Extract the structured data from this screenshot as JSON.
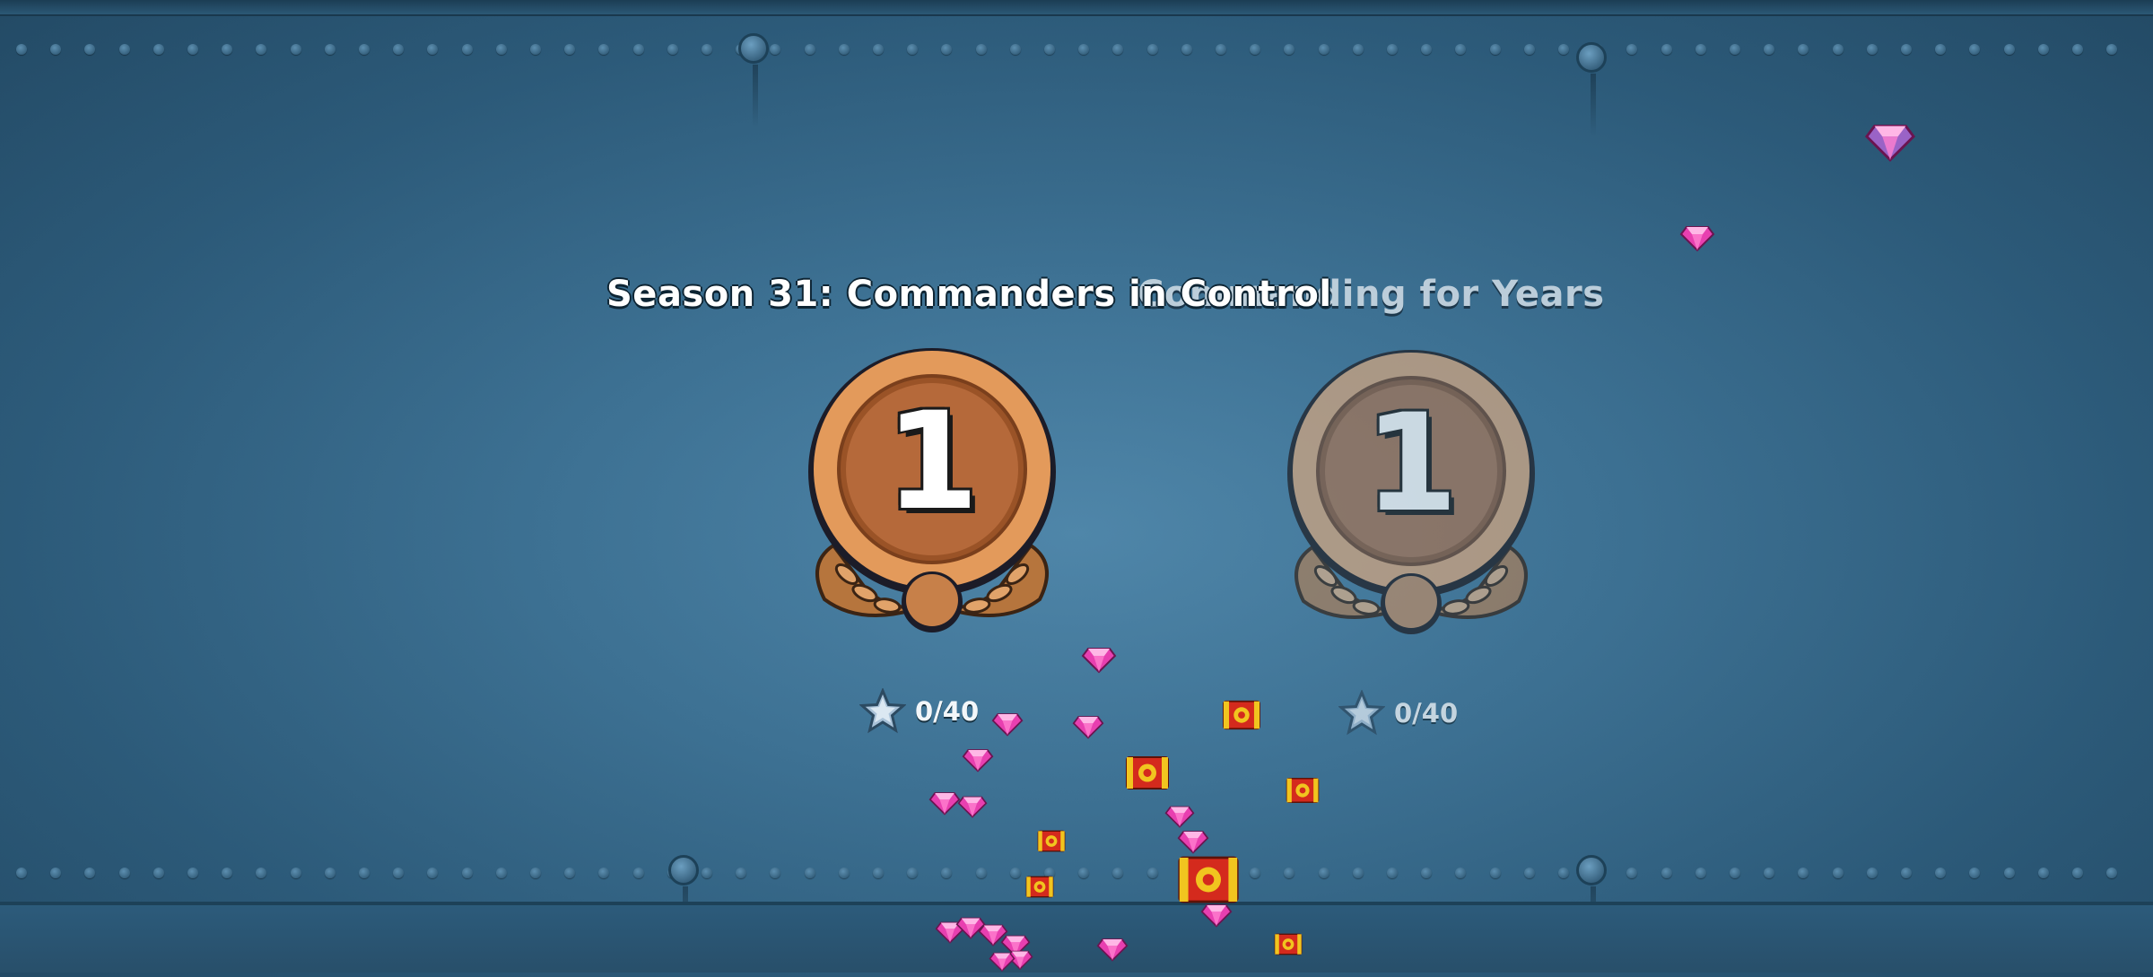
{
  "screen": {
    "seasons": [
      {
        "title": "Season 31: Commanders in Control",
        "rank": "1",
        "stars": "0/40",
        "active": true
      },
      {
        "title": "Commanding for Years",
        "rank": "1",
        "stars": "0/40",
        "active": false
      }
    ]
  },
  "icons": {
    "star": "star-icon",
    "gem": "gem-icon",
    "chest": "gear-chest-icon",
    "medal": "bronze-rank-medal-icon"
  },
  "colors": {
    "background": "#3d7193",
    "medal_bronze": "#c77e4a",
    "gem": "#e83fb0",
    "chest_red": "#d42a1d",
    "chest_gold": "#f1c51f"
  }
}
